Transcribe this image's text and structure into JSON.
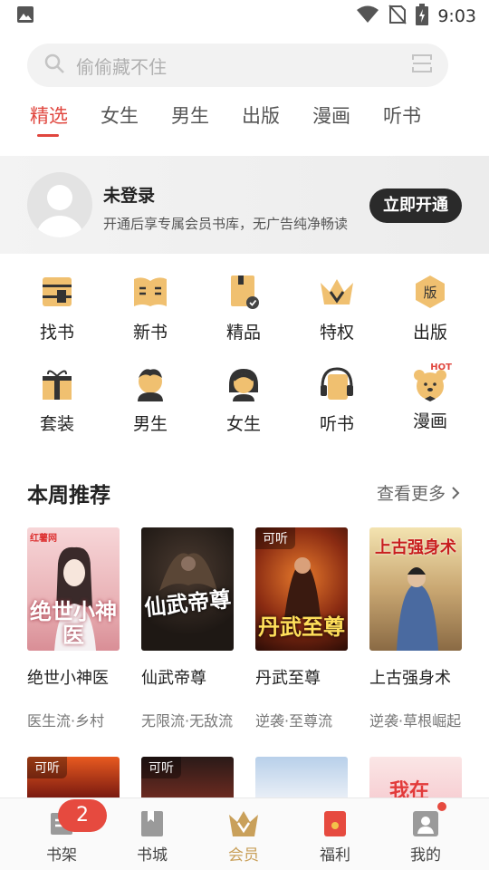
{
  "status_bar": {
    "time": "9:03"
  },
  "search": {
    "placeholder": "偷偷藏不住"
  },
  "tabs": [
    {
      "label": "精选",
      "active": true
    },
    {
      "label": "女生"
    },
    {
      "label": "男生"
    },
    {
      "label": "出版"
    },
    {
      "label": "漫画"
    },
    {
      "label": "听书"
    }
  ],
  "member": {
    "title": "未登录",
    "desc": "开通后享专属会员书库，无广告纯净畅读",
    "button": "立即开通"
  },
  "categories": [
    {
      "label": "找书",
      "icon": "find-book-icon"
    },
    {
      "label": "新书",
      "icon": "new-book-icon"
    },
    {
      "label": "精品",
      "icon": "premium-icon"
    },
    {
      "label": "特权",
      "icon": "crown-icon"
    },
    {
      "label": "出版",
      "icon": "publish-icon"
    },
    {
      "label": "套装",
      "icon": "gift-icon"
    },
    {
      "label": "男生",
      "icon": "boy-icon"
    },
    {
      "label": "女生",
      "icon": "girl-icon"
    },
    {
      "label": "听书",
      "icon": "headphones-icon"
    },
    {
      "label": "漫画",
      "icon": "bear-icon",
      "badge": "HOT"
    }
  ],
  "weekly": {
    "title": "本周推荐",
    "more": "查看更多",
    "books": [
      {
        "name": "绝世小神医",
        "tags": "医生流·乡村",
        "cover_title": "绝世小神医",
        "cover_label": "",
        "brand": "红薯网"
      },
      {
        "name": "仙武帝尊",
        "tags": "无限流·无敌流",
        "cover_title": "仙武帝尊",
        "cover_label": ""
      },
      {
        "name": "丹武至尊",
        "tags": "逆袭·至尊流",
        "cover_title": "丹武至尊",
        "cover_label": "可听"
      },
      {
        "name": "上古强身术",
        "tags": "逆袭·草根崛起",
        "cover_title": "上古强身术",
        "cover_label": ""
      }
    ],
    "row2_labels": [
      "可听",
      "可听"
    ],
    "row2_text": "我在"
  },
  "bottom_nav": [
    {
      "label": "书架",
      "icon": "bookshelf-icon",
      "badge": "2"
    },
    {
      "label": "书城",
      "icon": "bookstore-icon"
    },
    {
      "label": "会员",
      "icon": "vip-icon",
      "active": true
    },
    {
      "label": "福利",
      "icon": "red-packet-icon"
    },
    {
      "label": "我的",
      "icon": "profile-icon"
    }
  ],
  "colors": {
    "accent": "#e0463e",
    "vip_gold": "#c9a05a",
    "icon_gold": "#f0c070"
  }
}
